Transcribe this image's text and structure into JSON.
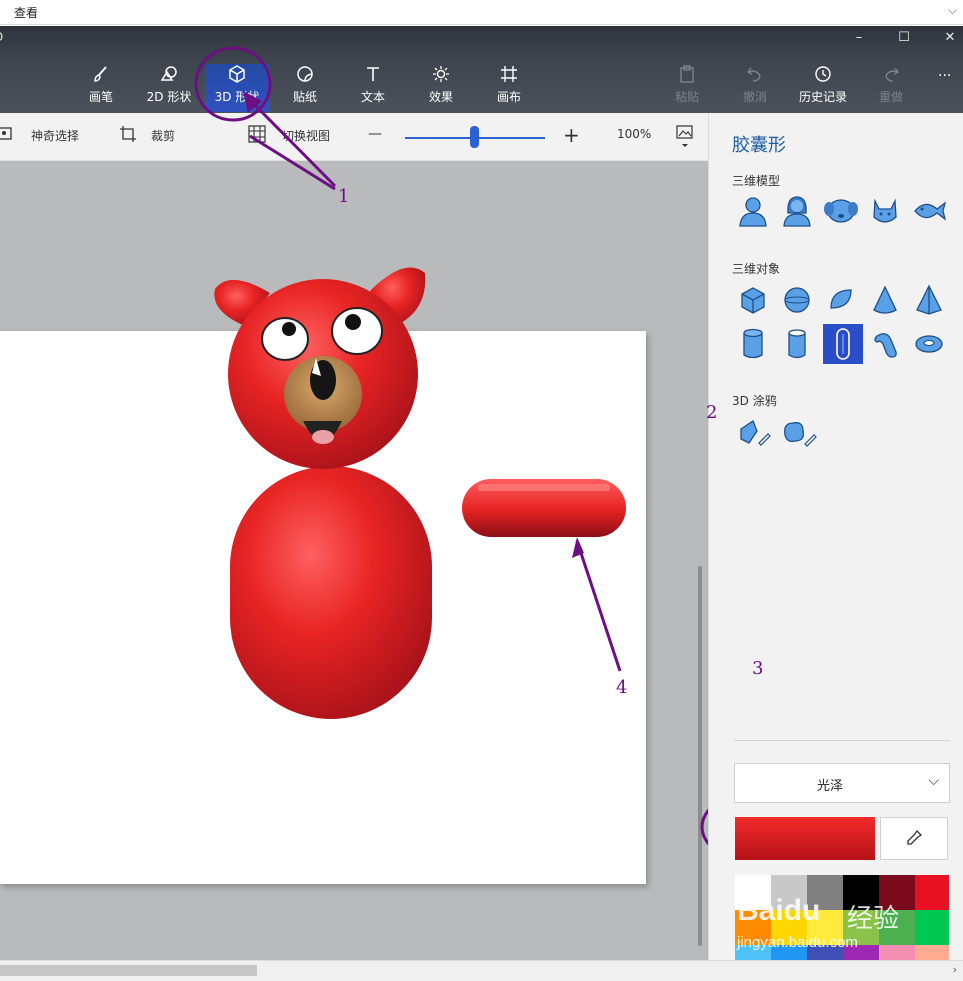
{
  "topbar": {
    "view_label": "查看",
    "chevron": "⌵"
  },
  "appbar": {
    "logo": "D",
    "window_controls": {
      "minimize": "–",
      "maximize": "☐",
      "close": "✕"
    },
    "tools": [
      {
        "label": "画笔",
        "icon": "brush-icon"
      },
      {
        "label": "2D 形状",
        "icon": "shapes-2d-icon"
      },
      {
        "label": "3D 形状",
        "icon": "cube-icon"
      },
      {
        "label": "贴纸",
        "icon": "sticker-icon"
      },
      {
        "label": "文本",
        "icon": "text-icon"
      },
      {
        "label": "效果",
        "icon": "effects-sun-icon"
      },
      {
        "label": "画布",
        "icon": "canvas-icon"
      }
    ],
    "actions": [
      {
        "label": "粘贴",
        "icon": "paste-icon"
      },
      {
        "label": "撤消",
        "icon": "undo-icon"
      },
      {
        "label": "历史记录",
        "icon": "history-icon"
      },
      {
        "label": "重做",
        "icon": "redo-icon"
      }
    ],
    "more": "···"
  },
  "subbar": {
    "magic_select": "神奇选择",
    "crop": "裁剪",
    "switch_view": "切换视图",
    "zoom_minus": "—",
    "zoom_plus": "+",
    "zoom_value": "100%",
    "zoom_level": 0.5
  },
  "panel": {
    "title": "胶囊形",
    "section_models": "三维模型",
    "models": [
      "man-model-icon",
      "woman-model-icon",
      "dog-model-icon",
      "cat-model-icon",
      "fish-model-icon"
    ],
    "section_objects": "三维对象",
    "objects": [
      "cube-icon",
      "sphere-icon",
      "hemisphere-icon",
      "cone-icon",
      "pyramid-icon",
      "cylinder-icon",
      "tube-icon",
      "capsule-icon",
      "torus-segment-icon",
      "donut-icon"
    ],
    "section_doodle": "3D 涂鸦",
    "doodles": [
      "sharp-doodle-icon",
      "soft-doodle-icon"
    ],
    "finish_label": "光泽",
    "current_color": "#e62020",
    "palette": [
      "#ffffff",
      "#c8c8c8",
      "#808080",
      "#000000",
      "#7a0a1c",
      "#e81123",
      "#ff8c00",
      "#ffd700",
      "#ffeb3b",
      "#8bc34a",
      "#4caf50",
      "#00c853",
      "#4fc3f7",
      "#2196f3",
      "#3f51b5",
      "#9c27b0",
      "#f48fb1",
      "#ffab91"
    ]
  },
  "watermark": {
    "brand": "Baidu",
    "suffix": "经验",
    "url": "jingyan.baidu.com"
  },
  "annotations": [
    "1",
    "2",
    "3",
    "4"
  ]
}
